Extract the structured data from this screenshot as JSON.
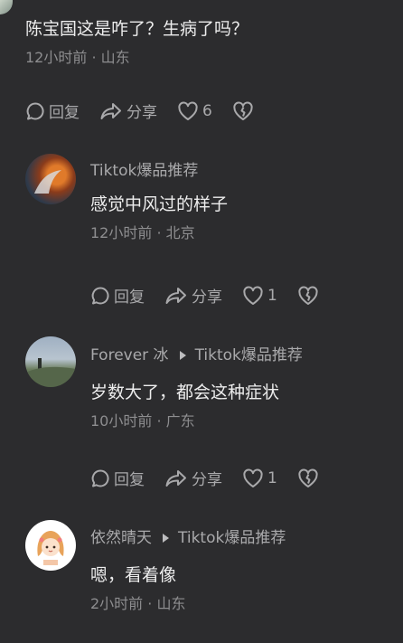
{
  "comment_top": {
    "text": "陈宝国这是咋了？生病了吗？",
    "meta": "12小时前 · 山东",
    "reply_label": "回复",
    "share_label": "分享",
    "like_count": "6"
  },
  "replies": [
    {
      "author": "Tiktok爆品推荐",
      "reply_to": "",
      "text": "感觉中风过的样子",
      "meta": "12小时前 · 北京",
      "reply_label": "回复",
      "share_label": "分享",
      "like_count": "1"
    },
    {
      "author": "Forever 冰",
      "reply_to": "Tiktok爆品推荐",
      "text": "岁数大了，都会这种症状",
      "meta": "10小时前 · 广东",
      "reply_label": "回复",
      "share_label": "分享",
      "like_count": "1"
    },
    {
      "author": "依然晴天",
      "reply_to": "Tiktok爆品推荐",
      "text": "嗯，看着像",
      "meta": "2小时前 · 山东"
    }
  ],
  "colors": {
    "background": "#2c2c2e",
    "text": "#ededed",
    "secondary": "#8d8d8f"
  }
}
